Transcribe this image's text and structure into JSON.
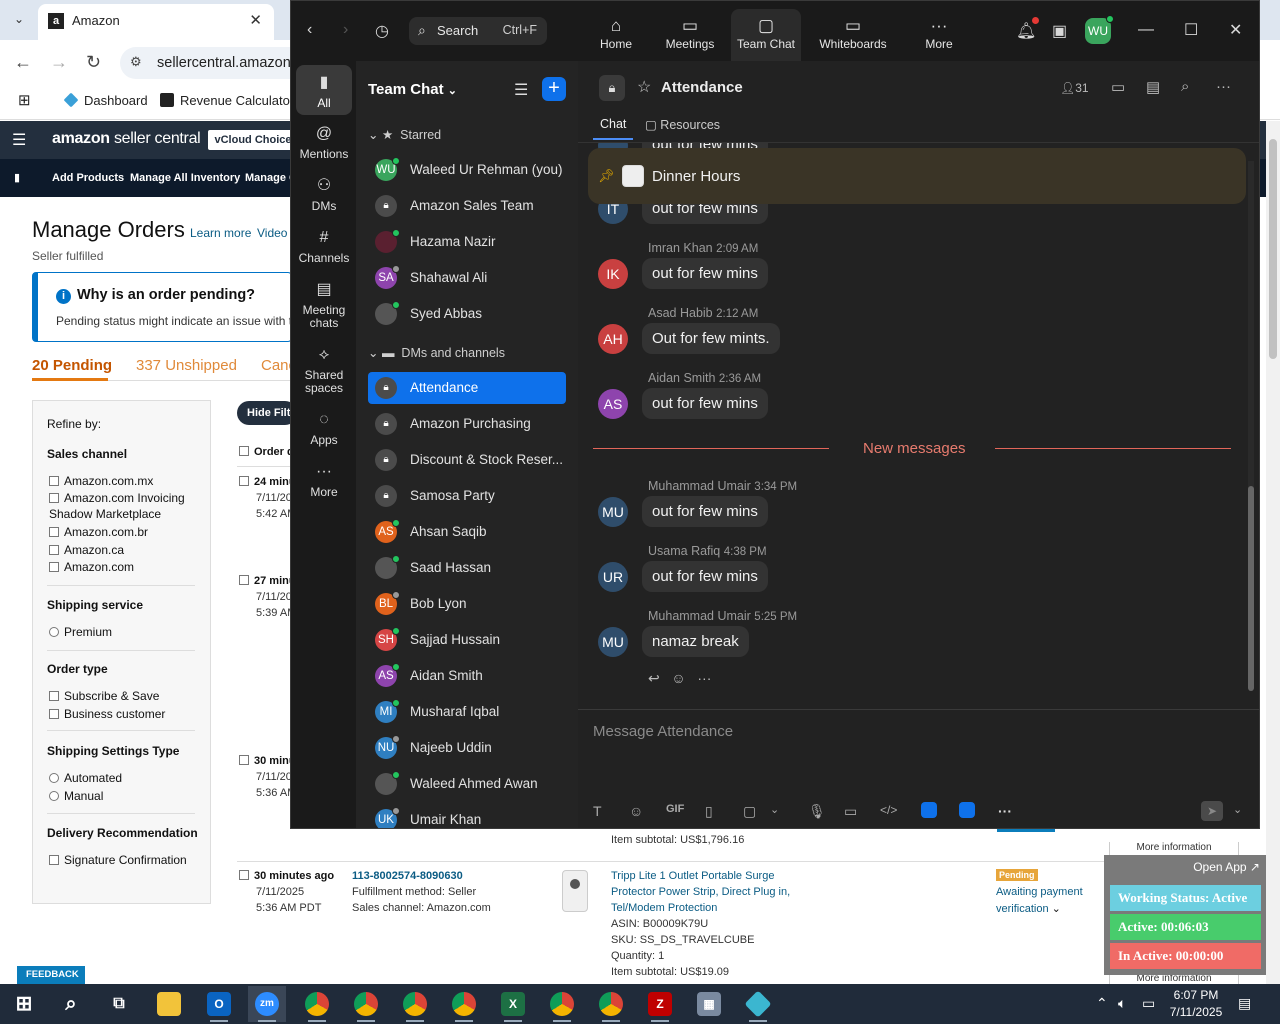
{
  "browser": {
    "tab_title": "Amazon",
    "url": "sellercentral.amazon.c",
    "bookmarks": [
      "Dashboard",
      "Revenue Calculator"
    ]
  },
  "amazon": {
    "logo_brand": "amazon",
    "logo_suffix": "seller central",
    "badge": "vCloud Choice",
    "subnav": [
      "Add Products",
      "Manage All Inventory",
      "Manage C"
    ],
    "page_title": "Manage Orders",
    "learn_more": "Learn more",
    "video": "Video",
    "seller_fulfilled": "Seller fulfilled",
    "pending_title": "Why is an order pending?",
    "pending_desc": "Pending status might indicate an issue with th",
    "order_tabs": [
      "20 Pending",
      "337 Unshipped",
      "Canc"
    ],
    "hide_filters": "Hide Filte",
    "refine": {
      "title": "Refine by:",
      "sales_channel": "Sales channel",
      "channels": [
        "Amazon.com.mx",
        "Amazon.com Invoicing",
        "Shadow Marketplace",
        "Amazon.com.br",
        "Amazon.ca",
        "Amazon.com"
      ],
      "shipping_service": "Shipping service",
      "premium": "Premium",
      "order_type": "Order type",
      "order_types": [
        "Subscribe & Save",
        "Business customer"
      ],
      "shipping_settings": "Shipping Settings Type",
      "settings": [
        "Automated",
        "Manual"
      ],
      "delivery": "Delivery Recommendation",
      "signature": "Signature Confirmation"
    },
    "order_col_header": "Order d",
    "orders": [
      {
        "age": "24 minu",
        "date": "7/11/20",
        "time": "5:42 AM"
      },
      {
        "age": "27 minu",
        "date": "7/11/20",
        "time": "5:39 AM"
      },
      {
        "age": "30 minu",
        "date": "7/11/20",
        "time": "5:36 AM"
      }
    ],
    "item_subtotal_1": "Item subtotal: US$1,796.16",
    "order_full": {
      "age": "30 minutes ago",
      "date": "7/11/2025",
      "time": "5:36 AM PDT",
      "order_id": "113-8002574-8090630",
      "fulfillment": "Fulfillment method: Seller",
      "channel": "Sales channel: Amazon.com",
      "product_l1": "Tripp Lite 1 Outlet Portable Surge",
      "product_l2": "Protector Power Strip, Direct Plug in,",
      "product_l3": "Tel/Modem Protection",
      "asin": "ASIN: B00009K79U",
      "sku": "SKU: SS_DS_TRAVELCUBE",
      "quantity": "Quantity: 1",
      "subtotal": "Item subtotal: US$19.09",
      "status_badge": "Pending",
      "status_l1": "Awaiting payment",
      "status_l2": "verification"
    },
    "more_info": "More information",
    "feedback": "FEEDBACK"
  },
  "widget": {
    "open_app": "Open App ↗",
    "working_status": "Working Status: Active",
    "active": "Active: 00:06:03",
    "inactive": "In Active: 00:00:00",
    "colors": {
      "working": "#6ccfe0",
      "active": "#48cc6c",
      "inactive": "#f06b66"
    }
  },
  "zoom": {
    "search_label": "Search",
    "search_shortcut": "Ctrl+F",
    "user_initials": "WU",
    "top_tabs": [
      {
        "label": "Home",
        "icon": "home-icon"
      },
      {
        "label": "Meetings",
        "icon": "video-icon"
      },
      {
        "label": "Team Chat",
        "icon": "chat-icon"
      },
      {
        "label": "Whiteboards",
        "icon": "whiteboard-icon"
      },
      {
        "label": "More",
        "icon": "more-icon"
      }
    ],
    "rail": [
      {
        "label": "All",
        "icon": "chat-icon"
      },
      {
        "label": "Mentions",
        "icon": "at-icon"
      },
      {
        "label": "DMs",
        "icon": "people-icon"
      },
      {
        "label": "Channels",
        "icon": "hash-icon"
      },
      {
        "label": "Meeting chats",
        "icon": "calendar-icon"
      },
      {
        "label": "Shared spaces",
        "icon": "share-icon"
      },
      {
        "label": "Apps",
        "icon": "apps-icon"
      },
      {
        "label": "More",
        "icon": "more-icon"
      }
    ],
    "list_title": "Team Chat",
    "starred_label": "Starred",
    "dms_label": "DMs and channels",
    "starred": [
      {
        "initials": "WU",
        "name": "Waleed Ur Rehman (you)",
        "color": "#3aa55d",
        "status": "#23c55e"
      },
      {
        "initials": "",
        "name": "Amazon Sales Team",
        "color": "#4b4b4b",
        "status": ""
      },
      {
        "initials": "",
        "name": "Hazama Nazir",
        "color": "#5a2030",
        "status": "#23c55e"
      },
      {
        "initials": "SA",
        "name": "Shahawal Ali",
        "color": "#8e44ad",
        "status": "#999"
      },
      {
        "initials": "",
        "name": "Syed Abbas",
        "color": "#555",
        "status": "#23c55e"
      }
    ],
    "channels": [
      {
        "initials": "",
        "name": "Attendance",
        "color": "#4b4b4b",
        "status": "",
        "selected": true
      },
      {
        "initials": "",
        "name": "Amazon Purchasing",
        "color": "#4b4b4b",
        "status": ""
      },
      {
        "initials": "",
        "name": "Discount & Stock Reser...",
        "color": "#4b4b4b",
        "status": ""
      },
      {
        "initials": "",
        "name": "Samosa Party",
        "color": "#4b4b4b",
        "status": ""
      },
      {
        "initials": "AS",
        "name": "Ahsan Saqib",
        "color": "#e0621c",
        "status": "#23c55e"
      },
      {
        "initials": "",
        "name": "Saad Hassan",
        "color": "#555",
        "status": "#23c55e"
      },
      {
        "initials": "BL",
        "name": "Bob Lyon",
        "color": "#e0621c",
        "status": "#999"
      },
      {
        "initials": "SH",
        "name": "Sajjad Hussain",
        "color": "#d64545",
        "status": "#23c55e"
      },
      {
        "initials": "AS",
        "name": "Aidan Smith",
        "color": "#8e44ad",
        "status": "#23c55e"
      },
      {
        "initials": "MI",
        "name": "Musharaf Iqbal",
        "color": "#2f7fc1",
        "status": "#23c55e"
      },
      {
        "initials": "NU",
        "name": "Najeeb Uddin",
        "color": "#2f7fc1",
        "status": "#999"
      },
      {
        "initials": "",
        "name": "Waleed Ahmed Awan",
        "color": "#555",
        "status": "#23c55e"
      },
      {
        "initials": "UK",
        "name": "Umair Khan",
        "color": "#2f7fc1",
        "status": "#999"
      }
    ],
    "channel_title": "Attendance",
    "member_count": "31",
    "sub_tabs": [
      "Chat",
      "Resources"
    ],
    "pinned": "Dinner Hours",
    "top_partial_message": "out for few mins",
    "messages_before": [
      {
        "initials": "IT",
        "author": "",
        "time": "",
        "text": "out for few mins",
        "color": "#2f4d6b"
      },
      {
        "initials": "IK",
        "author": "Imran Khan",
        "time": "2:09 AM",
        "text": "out for few mins",
        "color": "#c94040"
      },
      {
        "initials": "AH",
        "author": "Asad Habib",
        "time": "2:12 AM",
        "text": "Out for few mints.",
        "color": "#c94040"
      },
      {
        "initials": "AS",
        "author": "Aidan Smith",
        "time": "2:36 AM",
        "text": "out for few mins",
        "color": "#8e44ad"
      }
    ],
    "new_messages_label": "New messages",
    "messages_after": [
      {
        "initials": "MU",
        "author": "Muhammad Umair",
        "time": "3:34 PM",
        "text": "out for few mins",
        "color": "#2f4d6b"
      },
      {
        "initials": "UR",
        "author": "Usama Rafiq",
        "time": "4:38 PM",
        "text": "out for few mins",
        "color": "#2f4d6b"
      },
      {
        "initials": "MU",
        "author": "Muhammad Umair",
        "time": "5:25 PM",
        "text": "namaz break",
        "color": "#2f4d6b"
      }
    ],
    "composer_placeholder": "Message Attendance",
    "accent": "#0e71eb"
  },
  "taskbar": {
    "time": "6:07 PM",
    "date": "7/11/2025"
  }
}
